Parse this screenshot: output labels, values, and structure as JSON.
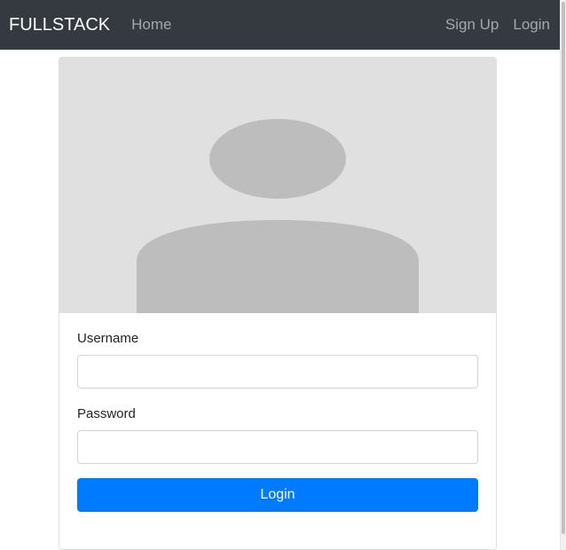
{
  "navbar": {
    "brand": "FULLSTACK",
    "home": "Home",
    "signup": "Sign Up",
    "login": "Login"
  },
  "form": {
    "username_label": "Username",
    "username_value": "",
    "password_label": "Password",
    "password_value": "",
    "submit_label": "Login"
  },
  "colors": {
    "navbar_bg": "#343a40",
    "primary": "#007bff",
    "avatar_bg": "#e0e0e0",
    "avatar_fg": "#bdbdbd"
  },
  "icons": {
    "profile": "user-placeholder-icon"
  }
}
